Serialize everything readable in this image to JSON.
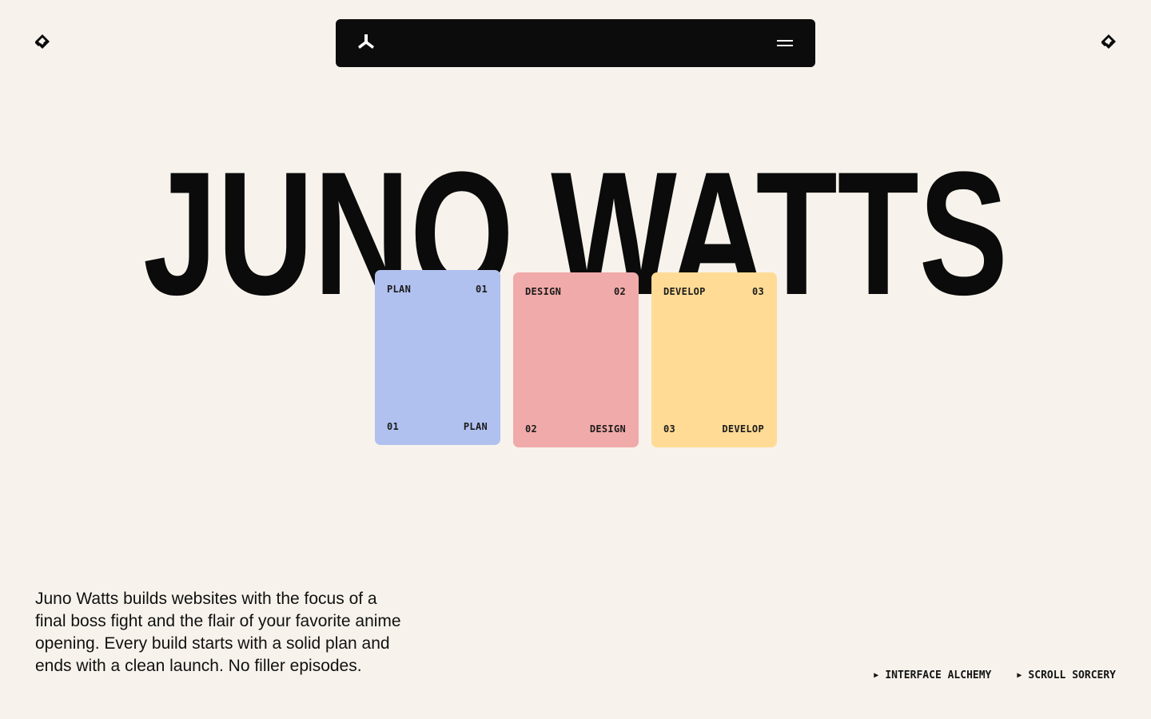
{
  "brand": {
    "name": "Juno Watts",
    "hero_title": "JUNO WATTS",
    "colors": {
      "background": "#f7f3ec",
      "ink": "#0b0b0b",
      "plan": "#b0c1ef",
      "design": "#f0aaa9",
      "develop": "#ffdb95"
    }
  },
  "header": {
    "left_icon": "diamond-loop-icon",
    "right_icon": "diamond-loop-icon",
    "nav_logo_icon": "tri-blade-logo-icon",
    "menu_icon": "hamburger-menu-icon"
  },
  "cards": [
    {
      "label": "PLAN",
      "number": "01"
    },
    {
      "label": "DESIGN",
      "number": "02"
    },
    {
      "label": "DEVELOP",
      "number": "03"
    }
  ],
  "blurb": "Juno Watts builds websites with the focus of a final boss fight and the flair of your favorite anime opening. Every build starts with a solid plan and ends with a clean launch. No filler episodes.",
  "footer_links": [
    {
      "arrow": "▶",
      "label": "INTERFACE ALCHEMY"
    },
    {
      "arrow": "▶",
      "label": "SCROLL SORCERY"
    }
  ]
}
